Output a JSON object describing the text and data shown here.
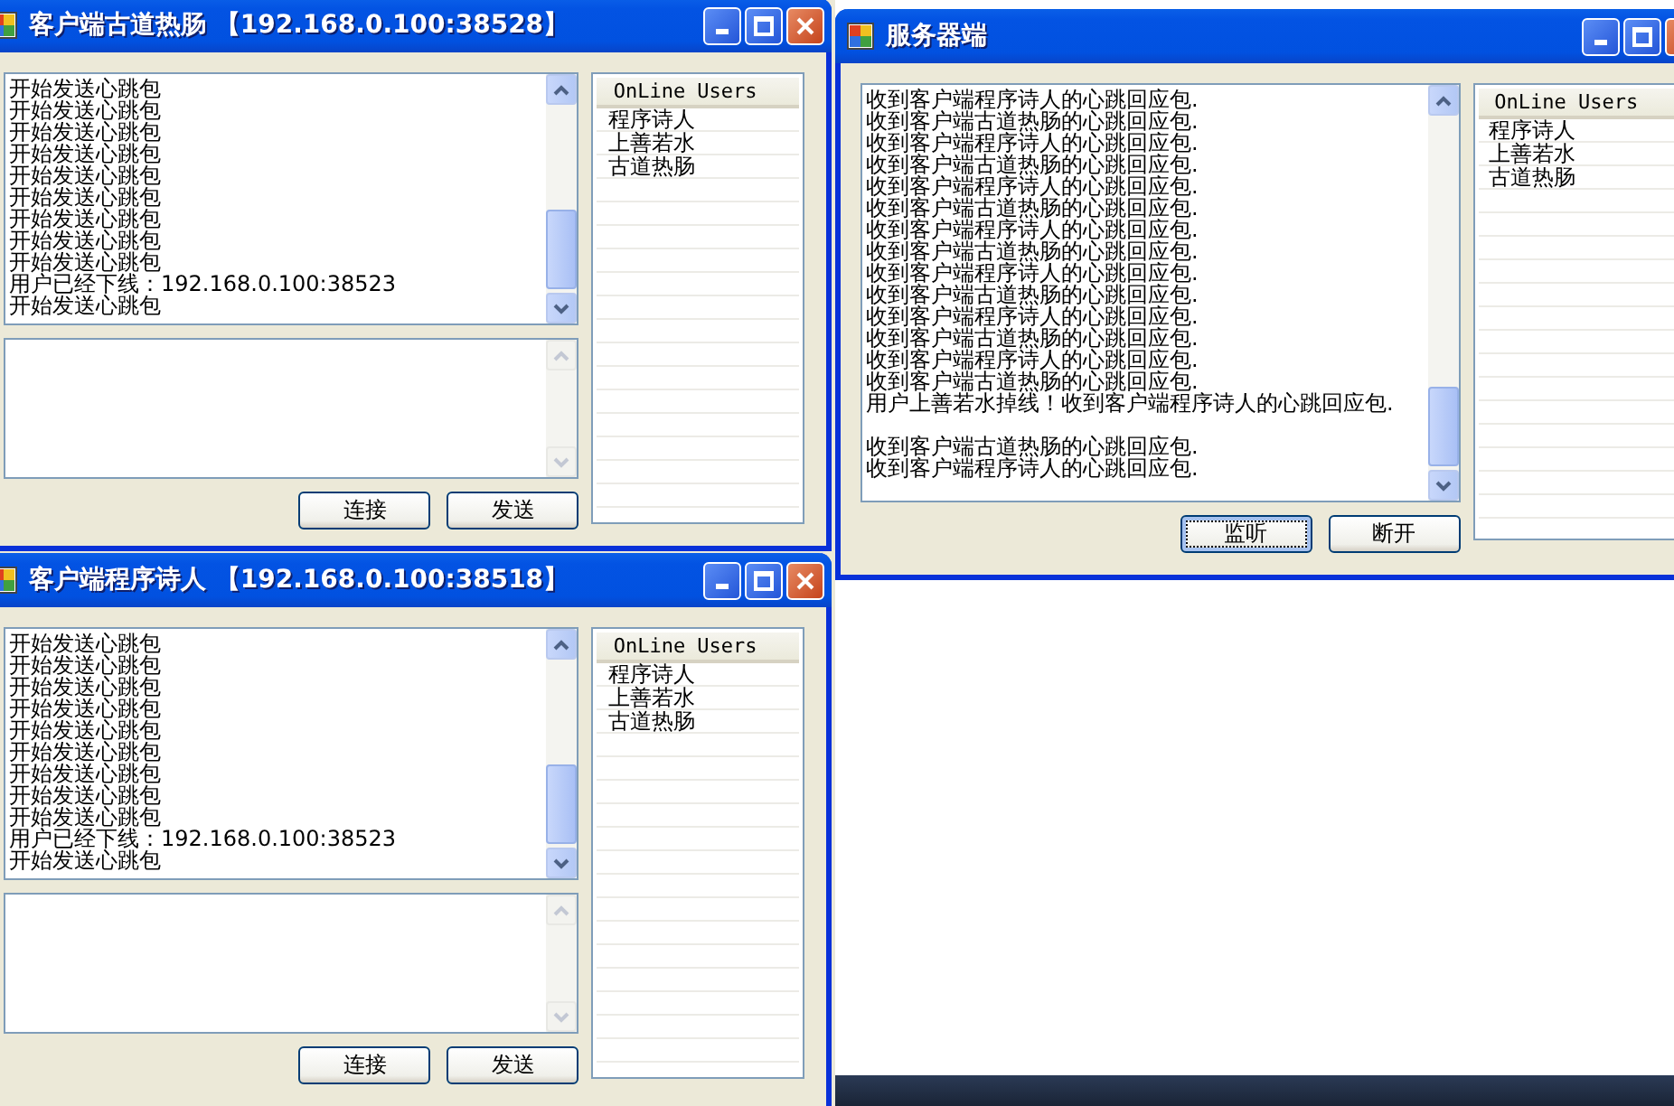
{
  "windows": [
    {
      "kind": "client",
      "title": "客户端古道热肠 【192.168.0.100:38528】",
      "log": [
        [
          "开始发送心跳包",
          "开始发送心跳包",
          "开始发送心跳包",
          "开始发送心跳包",
          "开始发送心跳包",
          "开始发送心跳包",
          "开始发送心跳包",
          "开始发送心跳包",
          "开始发送心跳包",
          "用户已经下线：192.168.0.100:38523",
          "开始发送心跳包"
        ]
      ],
      "buttons": [
        {
          "label": "连接",
          "focused": false
        },
        {
          "label": "发送",
          "focused": false
        }
      ],
      "users_header": "OnLine Users",
      "users": [
        "程序诗人",
        "上善若水",
        "古道热肠"
      ]
    },
    {
      "kind": "server",
      "title": "服务器端",
      "log": [
        [
          "收到客户端程序诗人的心跳回应包.",
          "收到客户端古道热肠的心跳回应包.",
          "收到客户端程序诗人的心跳回应包.",
          "收到客户端古道热肠的心跳回应包.",
          "收到客户端程序诗人的心跳回应包.",
          "收到客户端古道热肠的心跳回应包.",
          "收到客户端程序诗人的心跳回应包.",
          "收到客户端古道热肠的心跳回应包.",
          "收到客户端程序诗人的心跳回应包.",
          "收到客户端古道热肠的心跳回应包.",
          "收到客户端程序诗人的心跳回应包.",
          "收到客户端古道热肠的心跳回应包.",
          "收到客户端程序诗人的心跳回应包.",
          "收到客户端古道热肠的心跳回应包.",
          "用户上善若水掉线！收到客户端程序诗人的心跳回应包."
        ],
        [
          "收到客户端古道热肠的心跳回应包.",
          "收到客户端程序诗人的心跳回应包."
        ]
      ],
      "buttons": [
        {
          "label": "监听",
          "focused": true
        },
        {
          "label": "断开",
          "focused": false
        }
      ],
      "users_header": "OnLine Users",
      "users": [
        "程序诗人",
        "上善若水",
        "古道热肠"
      ]
    },
    {
      "kind": "client",
      "title": "客户端程序诗人 【192.168.0.100:38518】",
      "log": [
        [
          "开始发送心跳包",
          "开始发送心跳包",
          "开始发送心跳包",
          "开始发送心跳包",
          "开始发送心跳包",
          "开始发送心跳包",
          "开始发送心跳包",
          "开始发送心跳包",
          "开始发送心跳包",
          "用户已经下线：192.168.0.100:38523",
          "开始发送心跳包"
        ]
      ],
      "buttons": [
        {
          "label": "连接",
          "focused": false
        },
        {
          "label": "发送",
          "focused": false
        }
      ],
      "users_header": "OnLine Users",
      "users": [
        "程序诗人",
        "上善若水",
        "古道热肠"
      ]
    }
  ]
}
